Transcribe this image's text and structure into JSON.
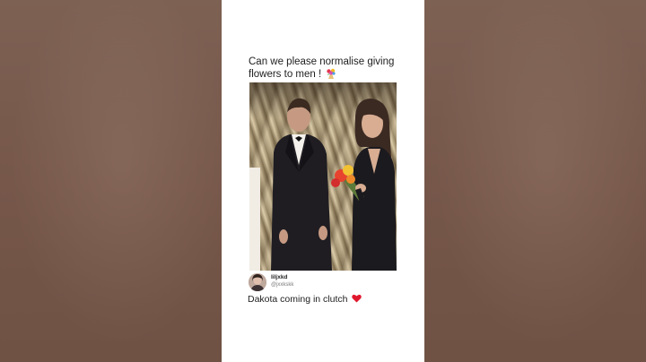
{
  "post": {
    "text_line1": "Can we please normalise giving",
    "text_line2": "flowers to men !",
    "flower_emoji_icon": "bouquet-icon"
  },
  "reply": {
    "username": "liljxkd",
    "handle": "@jxxkskk",
    "text": "Dakota coming in clutch",
    "heart_icon": "red-heart-icon"
  },
  "colors": {
    "background_side": "#7a5a4b",
    "card_bg": "#ffffff",
    "text": "#1e1e1e",
    "heart": "#e0182e"
  }
}
